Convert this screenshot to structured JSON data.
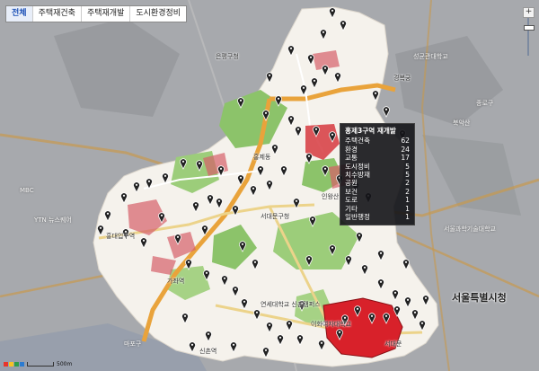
{
  "tabs": [
    {
      "label": "전체",
      "active": true
    },
    {
      "label": "주택재건축",
      "active": false
    },
    {
      "label": "주택재개발",
      "active": false
    },
    {
      "label": "도시환경정비",
      "active": false
    }
  ],
  "zoom": {
    "plus": "+"
  },
  "popup": {
    "title": "홍제3구역 재개발",
    "rows": [
      {
        "label": "주택건축",
        "value": "62"
      },
      {
        "label": "환경",
        "value": "24"
      },
      {
        "label": "교통",
        "value": "17"
      },
      {
        "label": "도시정비",
        "value": "5"
      },
      {
        "label": "치수방재",
        "value": "5"
      },
      {
        "label": "공원",
        "value": "2"
      },
      {
        "label": "보건",
        "value": "2"
      },
      {
        "label": "도로",
        "value": "1"
      },
      {
        "label": "기타",
        "value": "1"
      },
      {
        "label": "일반행정",
        "value": "1"
      }
    ]
  },
  "map_labels": {
    "city_hall": "서울특별시청",
    "gyeongbokgung": "경복궁",
    "seodaemun": "서대문구청",
    "eunpyeong": "은평구청",
    "jongno": "종로구",
    "mapo": "마포구",
    "hongdae": "홍대입구역",
    "sinchon": "신촌역",
    "yonsei": "연세대학교 신촌캠퍼스",
    "ewha": "이화여자대학교",
    "seoul_univ": "서울과학기술대학교",
    "bugaksan": "북악산",
    "inwangsan": "인왕산",
    "sungkyunkwan": "성균관대학교",
    "hongje": "홍제동",
    "gajwa": "가좌역",
    "seodaemun_stn": "서대문",
    "ytn": "YTN 뉴스퀘어",
    "mbc": "MBC",
    "scale": "500m"
  },
  "colors": {
    "popup_bg": "#141418",
    "redevelopment_area": "#d8212a",
    "district_area": "#f7f3ee",
    "park": "#8dc36b",
    "road_major": "#e9a33b",
    "marker": "#222222"
  }
}
